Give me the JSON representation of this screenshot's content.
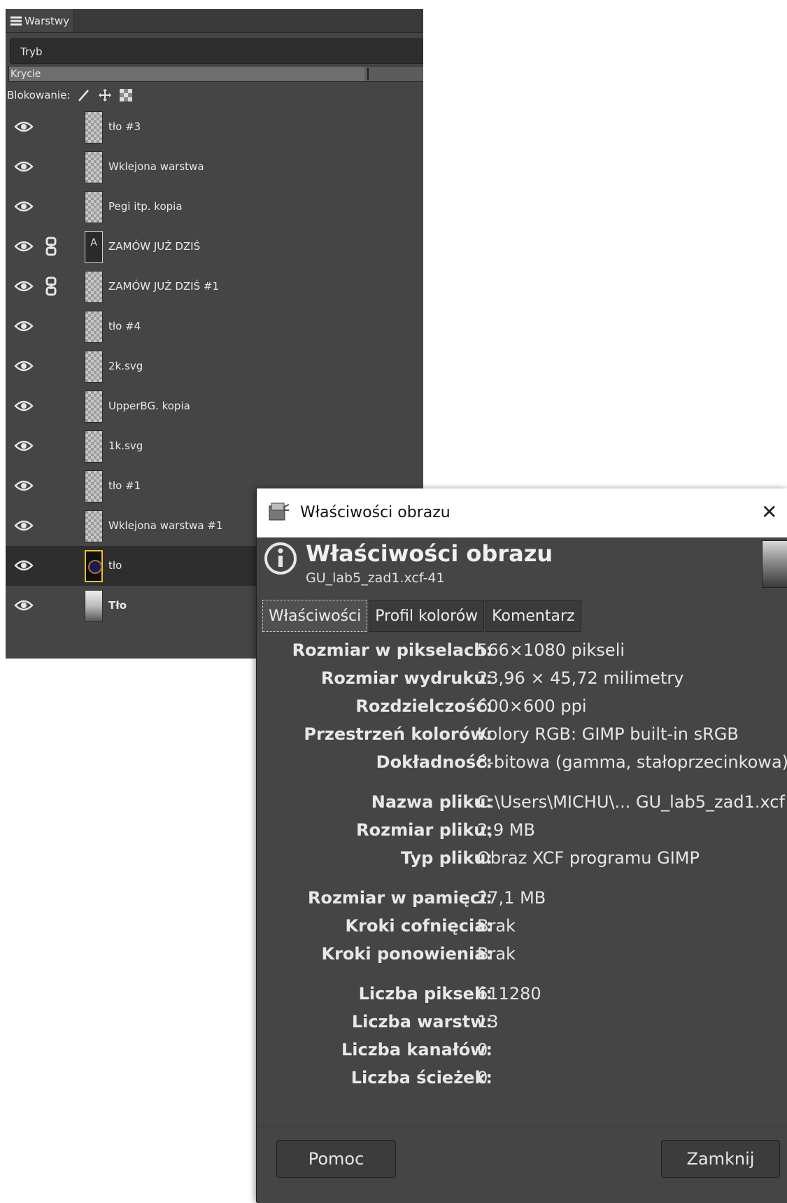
{
  "layers_panel": {
    "tab_label": "Warstwy",
    "mode_label": "Tryb",
    "opacity_label": "Krycie",
    "lock_label": "Blokowanie:",
    "layers": [
      {
        "name": "tło #3",
        "thumb": "transparent",
        "chain": false
      },
      {
        "name": "Wklejona warstwa",
        "thumb": "transparent",
        "chain": false
      },
      {
        "name": "Pegi itp. kopia",
        "thumb": "transparent",
        "chain": false
      },
      {
        "name": "ZAMÓW JUŻ DZIŚ",
        "thumb": "text",
        "chain": true
      },
      {
        "name": "ZAMÓW JUŻ DZIŚ #1",
        "thumb": "transparent",
        "chain": true
      },
      {
        "name": "tło #4",
        "thumb": "transparent",
        "chain": false
      },
      {
        "name": "2k.svg",
        "thumb": "transparent",
        "chain": false
      },
      {
        "name": "UpperBG. kopia",
        "thumb": "transparent",
        "chain": false
      },
      {
        "name": "1k.svg",
        "thumb": "transparent",
        "chain": false
      },
      {
        "name": "tło #1",
        "thumb": "transparent",
        "chain": false
      },
      {
        "name": "Wklejona warstwa #1",
        "thumb": "transparent",
        "chain": false
      },
      {
        "name": "tło",
        "thumb": "selected",
        "chain": false,
        "active": true
      },
      {
        "name": "Tło",
        "thumb": "photo",
        "chain": false,
        "bold": true
      }
    ]
  },
  "dialog": {
    "window_title": "Właściwości obrazu",
    "heading": "Właściwości obrazu",
    "subheading": "GU_lab5_zad1.xcf-41",
    "tabs": [
      "Właściwości",
      "Profil kolorów",
      "Komentarz"
    ],
    "properties": [
      {
        "key": "Rozmiar w pikselach:",
        "value": "566×1080 pikseli"
      },
      {
        "key": "Rozmiar wydruku:",
        "value": "23,96 × 45,72 milimetry"
      },
      {
        "key": "Rozdzielczość:",
        "value": "600×600 ppi"
      },
      {
        "key": "Przestrzeń kolorów:",
        "value": "Kolory RGB: GIMP built-in sRGB"
      },
      {
        "key": "Dokładność:",
        "value": "8-bitowa (gamma, stałoprzecinkowa)"
      },
      {
        "key": "Nazwa pliku:",
        "value": "C:\\Users\\MICHU\\... GU_lab5_zad1.xcf"
      },
      {
        "key": "Rozmiar pliku:",
        "value": "2,9 MB"
      },
      {
        "key": "Typ pliku:",
        "value": "Obraz XCF programu GIMP"
      },
      {
        "key": "Rozmiar w pamięci:",
        "value": "27,1 MB"
      },
      {
        "key": "Kroki cofnięcia:",
        "value": "Brak"
      },
      {
        "key": "Kroki ponowienia:",
        "value": "Brak"
      },
      {
        "key": "Liczba pikseli:",
        "value": "611280"
      },
      {
        "key": "Liczba warstw:",
        "value": "13"
      },
      {
        "key": "Liczba kanałów:",
        "value": "0"
      },
      {
        "key": "Liczba ścieżek:",
        "value": "0"
      }
    ],
    "help_button": "Pomoc",
    "close_button": "Zamknij"
  }
}
